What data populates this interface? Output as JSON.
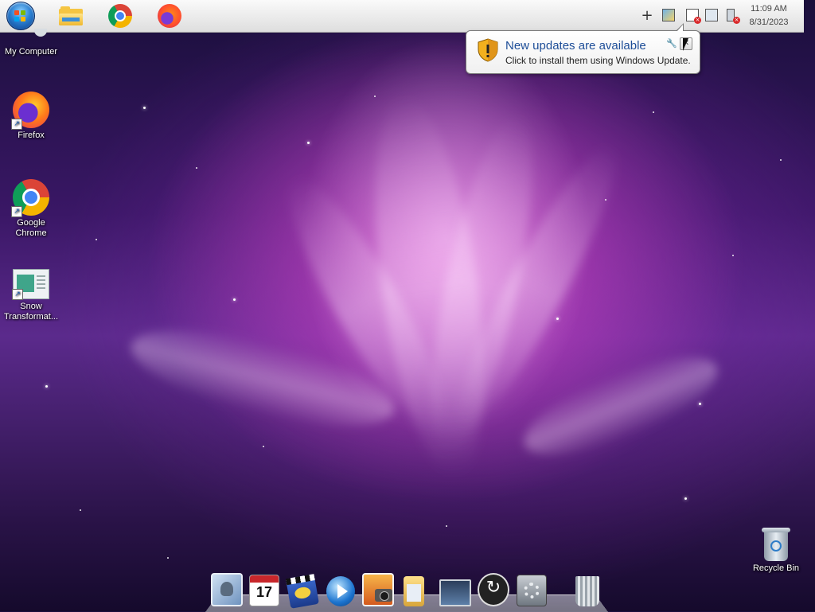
{
  "taskbar": {
    "start_button": "start-orb",
    "pinned": [
      "file-explorer",
      "google-chrome",
      "firefox"
    ],
    "tray_icons": [
      "plus-icon",
      "network-monitor-icon",
      "action-center-flag-icon",
      "network-disconnected-icon",
      "volume-muted-icon"
    ],
    "tray_plus": "+",
    "clock": {
      "time": "11:09 AM",
      "date": "8/31/2023"
    }
  },
  "notification": {
    "title": "New updates are available",
    "text": "Click to install them using Windows Update.",
    "close_glyph": "✕",
    "wrench_glyph": "🔧"
  },
  "desktop": {
    "icons": [
      {
        "label": "My Computer"
      },
      {
        "label": "Firefox"
      },
      {
        "label": "Google Chrome"
      },
      {
        "label": "Snow Transformat..."
      },
      {
        "label": "Recycle Bin"
      }
    ]
  },
  "dock": {
    "items": [
      "mail-icon",
      "calendar-icon",
      "imovie-icon",
      "quicktime-icon",
      "iphoto-icon",
      "documents-folder-icon",
      "display-icon",
      "time-machine-icon",
      "system-preferences-icon",
      "trash-icon"
    ],
    "calendar_day": "17"
  },
  "colors": {
    "taskbar_bg": "#e6e6e6",
    "balloon_title": "#1e4e98",
    "wallpaper_accent": "#d64ac8"
  }
}
